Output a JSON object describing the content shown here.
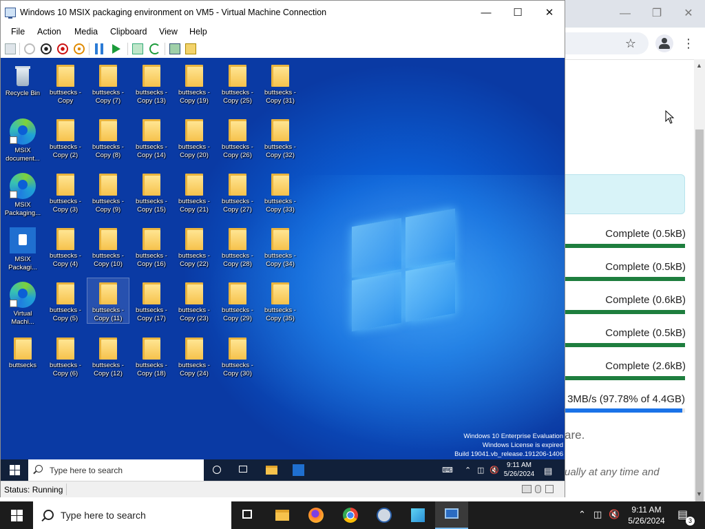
{
  "vm": {
    "title": "Windows 10 MSIX packaging environment on VM5 - Virtual Machine Connection",
    "menu": [
      "File",
      "Action",
      "Media",
      "Clipboard",
      "View",
      "Help"
    ],
    "status": "Status: Running"
  },
  "guest": {
    "desktop": {
      "system_icons": [
        {
          "label": "Recycle Bin"
        },
        {
          "label": "MSIX document..."
        },
        {
          "label": "MSIX Packaging..."
        },
        {
          "label": "MSIX Packagi..."
        },
        {
          "label": "Virtual Machi..."
        },
        {
          "label": "buttsecks"
        }
      ],
      "folder_columns": [
        [
          "buttsecks - Copy",
          "buttsecks - Copy (2)",
          "buttsecks - Copy (3)",
          "buttsecks - Copy (4)",
          "buttsecks - Copy (5)",
          "buttsecks - Copy (6)"
        ],
        [
          "buttsecks - Copy (7)",
          "buttsecks - Copy (8)",
          "buttsecks - Copy (9)",
          "buttsecks - Copy (10)",
          "buttsecks - Copy (11)",
          "buttsecks - Copy (12)"
        ],
        [
          "buttsecks - Copy (13)",
          "buttsecks - Copy (14)",
          "buttsecks - Copy (15)",
          "buttsecks - Copy (16)",
          "buttsecks - Copy (17)",
          "buttsecks - Copy (18)"
        ],
        [
          "buttsecks - Copy (19)",
          "buttsecks - Copy (20)",
          "buttsecks - Copy (21)",
          "buttsecks - Copy (22)",
          "buttsecks - Copy (23)",
          "buttsecks - Copy (24)"
        ],
        [
          "buttsecks - Copy (25)",
          "buttsecks - Copy (26)",
          "buttsecks - Copy (27)",
          "buttsecks - Copy (28)",
          "buttsecks - Copy (29)",
          "buttsecks - Copy (30)"
        ],
        [
          "buttsecks - Copy (31)",
          "buttsecks - Copy (32)",
          "buttsecks - Copy (33)",
          "buttsecks - Copy (34)",
          "buttsecks - Copy (35)"
        ]
      ],
      "selected": "buttsecks - Copy (11)"
    },
    "watermark": [
      "Windows 10 Enterprise Evaluation",
      "Windows License is expired",
      "Build 19041.vb_release.191206-1406"
    ],
    "taskbar": {
      "search_placeholder": "Type here to search",
      "clock_time": "9:11 AM",
      "clock_date": "5/26/2024"
    }
  },
  "host": {
    "downloads": [
      {
        "status": "Complete (0.5kB)",
        "progress": 1.0
      },
      {
        "status": "Complete (0.5kB)",
        "progress": 1.0
      },
      {
        "status": "Complete (0.6kB)",
        "progress": 1.0
      },
      {
        "status": "Complete (0.5kB)",
        "progress": 1.0
      },
      {
        "status": "Complete (2.6kB)",
        "progress": 1.0
      }
    ],
    "active_download": {
      "status": "3MB/s (97.78% of 4.4GB)",
      "progress": 0.9778
    },
    "text_fragment_1": "are.",
    "text_fragment_2": "ually at any time and",
    "taskbar": {
      "search_placeholder": "Type here to search",
      "clock_time": "9:11 AM",
      "clock_date": "5/26/2024",
      "notification_count": "3"
    }
  },
  "colors": {
    "download_complete": "#1e7e3e",
    "download_active": "#1a73e8",
    "guest_taskbar": "#11203a",
    "host_taskbar": "#1c1c1c"
  }
}
